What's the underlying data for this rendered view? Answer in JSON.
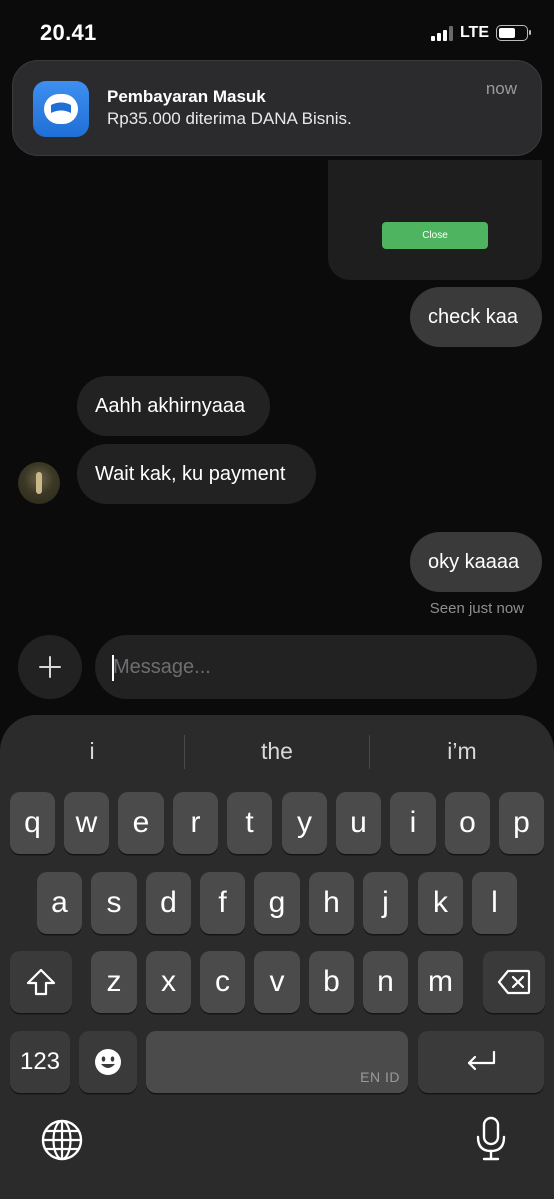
{
  "status_bar": {
    "time": "20.41",
    "network": "LTE",
    "battery_level": 0.6,
    "signal_bars": 3
  },
  "notification": {
    "app_icon": "dana-wallet-icon",
    "title": "Pembayaran Masuk",
    "body": "Rp35.000 diterima DANA Bisnis.",
    "time": "now"
  },
  "chat": {
    "embedded_button_label": "Close",
    "messages": [
      {
        "direction": "out",
        "text": "check kaa"
      },
      {
        "direction": "in",
        "text": "Aahh akhirnyaaa"
      },
      {
        "direction": "in",
        "text": "Wait kak, ku payment"
      },
      {
        "direction": "out",
        "text": "oky kaaaa"
      }
    ],
    "seen_status": "Seen just now"
  },
  "composer": {
    "add_icon": "plus-icon",
    "placeholder": "Message..."
  },
  "keyboard": {
    "suggestions": [
      "i",
      "the",
      "i’m"
    ],
    "row1": [
      "q",
      "w",
      "e",
      "r",
      "t",
      "y",
      "u",
      "i",
      "o",
      "p"
    ],
    "row2": [
      "a",
      "s",
      "d",
      "f",
      "g",
      "h",
      "j",
      "k",
      "l"
    ],
    "row3": [
      "z",
      "x",
      "c",
      "v",
      "b",
      "n",
      "m"
    ],
    "numbers_label": "123",
    "space_language": "EN ID",
    "icons": {
      "shift": "shift-icon",
      "delete": "backspace-icon",
      "emoji": "emoji-icon",
      "return": "return-icon",
      "globe": "globe-icon",
      "mic": "microphone-icon"
    }
  },
  "colors": {
    "background": "#0b0b0b",
    "outgoing_bubble": "#3a3a3a",
    "incoming_bubble": "#222222",
    "keyboard": "#2b2b2b",
    "key": "#4b4b4b",
    "close_button": "#4fb45f",
    "dana_blue": "#1f6fd6"
  }
}
